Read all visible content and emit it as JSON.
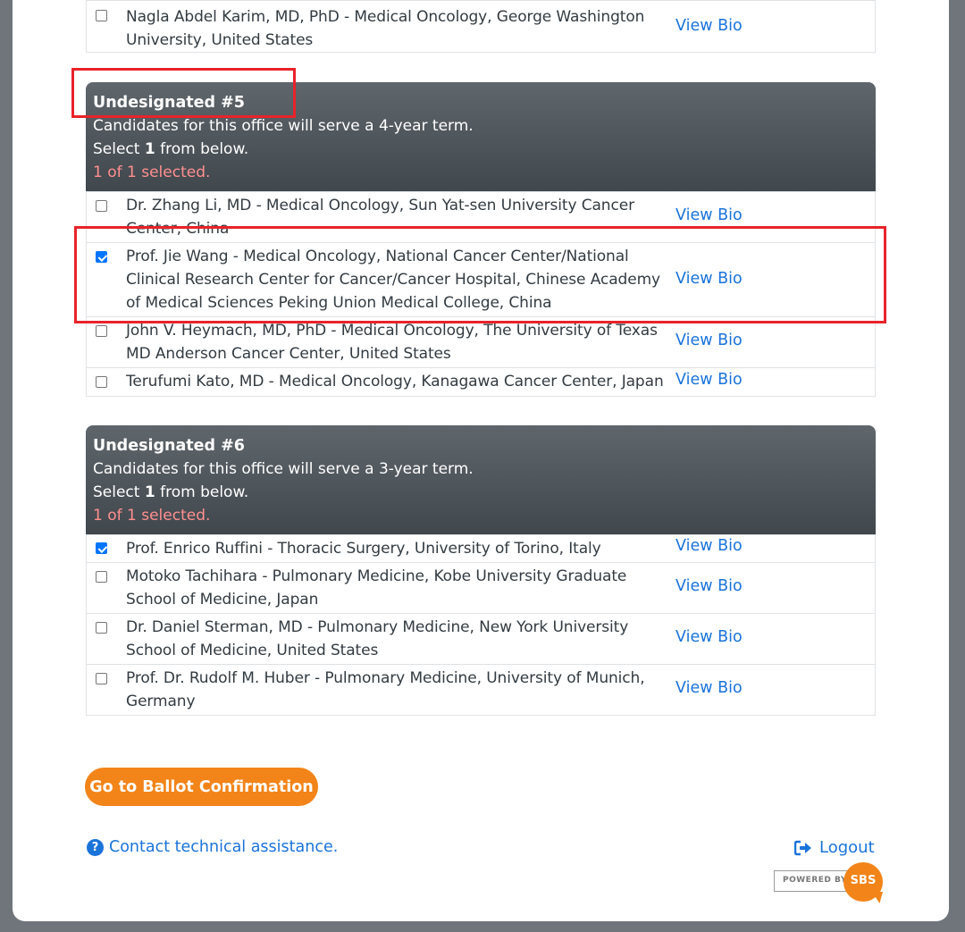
{
  "prior_section": {
    "rows": [
      {
        "name": "Nagla Abdel Karim, MD, PhD - Medical Oncology, George Washington University, United States",
        "bio": "View Bio",
        "checked": false
      }
    ]
  },
  "section5": {
    "title": "Undesignated #5",
    "term": "Candidates for this office will serve a 4-year term.",
    "select_prefix": "Select ",
    "select_count": "1",
    "select_suffix": " from below.",
    "selected_status": "1 of 1 selected.",
    "rows": [
      {
        "name": "Dr. Zhang Li, MD - Medical Oncology, Sun Yat-sen University Cancer Center, China",
        "bio": "View Bio",
        "checked": false
      },
      {
        "name": "Prof. Jie Wang - Medical Oncology, National Cancer Center/National Clinical Research Center for Cancer/Cancer Hospital, Chinese Academy of Medical Sciences Peking Union Medical College, China",
        "bio": "View Bio",
        "checked": true
      },
      {
        "name": "John V. Heymach, MD, PhD - Medical Oncology, The University of Texas MD Anderson Cancer Center, United States",
        "bio": "View Bio",
        "checked": false
      },
      {
        "name": "Terufumi Kato, MD - Medical Oncology, Kanagawa Cancer Center, Japan",
        "bio": "View Bio",
        "checked": false
      }
    ]
  },
  "section6": {
    "title": "Undesignated #6",
    "term": "Candidates for this office will serve a 3-year term.",
    "select_prefix": "Select ",
    "select_count": "1",
    "select_suffix": " from below.",
    "selected_status": "1 of 1 selected.",
    "rows": [
      {
        "name": "Prof. Enrico Ruffini - Thoracic Surgery, University of Torino, Italy",
        "bio": "View Bio",
        "checked": true
      },
      {
        "name": "Motoko Tachihara - Pulmonary Medicine, Kobe University Graduate School of Medicine, Japan",
        "bio": "View Bio",
        "checked": false
      },
      {
        "name": "Dr. Daniel Sterman, MD - Pulmonary Medicine, New York University School of Medicine, United States",
        "bio": "View Bio",
        "checked": false
      },
      {
        "name": "Prof. Dr. Rudolf M. Huber - Pulmonary Medicine, University of Munich, Germany",
        "bio": "View Bio",
        "checked": false
      }
    ]
  },
  "footer": {
    "confirm_button": "Go to Ballot Confirmation",
    "help_link": "Contact technical assistance.",
    "logout_link": "Logout",
    "powered_by": "POWERED BY",
    "brand": "SBS"
  },
  "colors": {
    "accent_orange": "#f28419",
    "link_blue": "#1a73d9",
    "selected_red": "#ff8f8f",
    "annotation_red": "#e8232a"
  }
}
